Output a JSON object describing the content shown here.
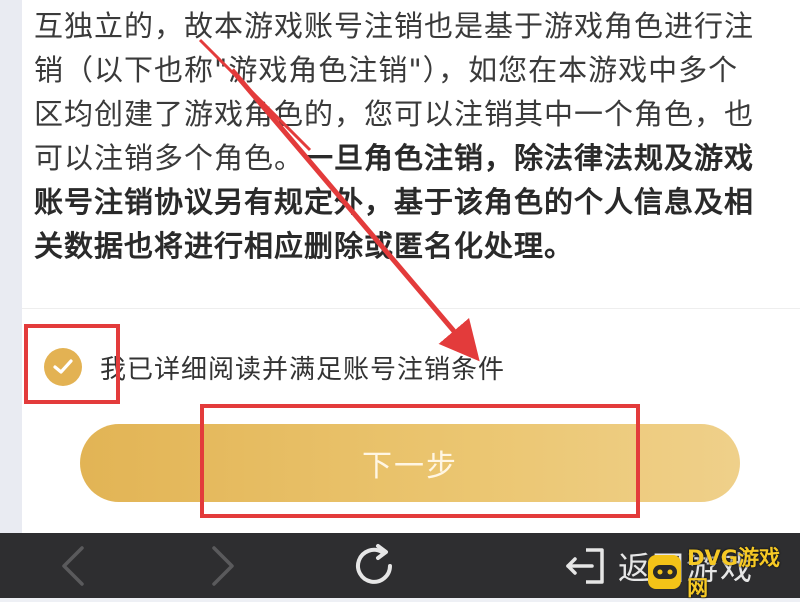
{
  "notice": {
    "line1": "互独立的，故本游戏账号注销也是基于游戏角色进行注",
    "line2": "销（以下也称\"游戏角色注销\"），如您在本游戏中多个",
    "line3": "区均创建了游戏角色的，您可以注销其中一个角色，也",
    "line4_normal": "可以注销多个角色。",
    "line4_bold": "一旦角色注销，除法律法规及游戏",
    "line5": "账号注销协议另有规定外，基于该角色的个人信息及相",
    "line6": "关数据也将进行相应删除或匿名化处理。"
  },
  "agreement": {
    "label": "我已详细阅读并满足账号注销条件",
    "checked": true
  },
  "next_button": {
    "label": "下一步"
  },
  "nav": {
    "return_label": "返回游戏"
  },
  "watermark": {
    "text": "DVG游戏网"
  },
  "colors": {
    "accent": "#e3b253",
    "highlight_red": "#e33b3b",
    "nav_background": "#2e2e30"
  }
}
